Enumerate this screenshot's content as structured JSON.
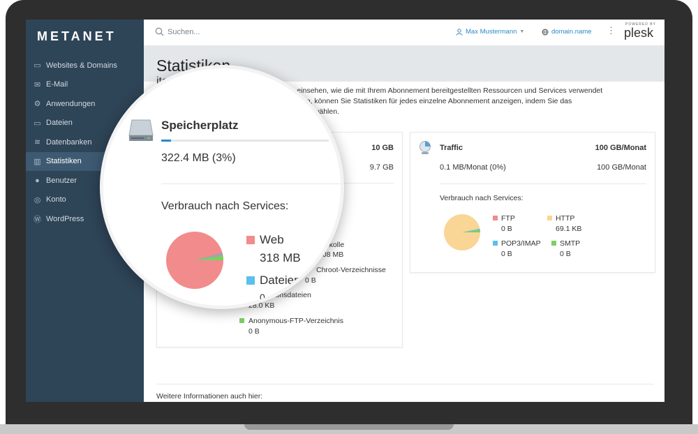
{
  "brand": {
    "logo": "METANET"
  },
  "sidebar": {
    "items": [
      {
        "label": "Websites & Domains",
        "icon": "monitor-icon",
        "glyph": "▭"
      },
      {
        "label": "E-Mail",
        "icon": "mail-icon",
        "glyph": "✉"
      },
      {
        "label": "Anwendungen",
        "icon": "gear-icon",
        "glyph": "⚙"
      },
      {
        "label": "Dateien",
        "icon": "folder-icon",
        "glyph": "▭"
      },
      {
        "label": "Datenbanken",
        "icon": "layers-icon",
        "glyph": "≋"
      },
      {
        "label": "Statistiken",
        "icon": "bar-chart-icon",
        "glyph": "▥",
        "active": true
      },
      {
        "label": "Benutzer",
        "icon": "user-icon",
        "glyph": "●"
      },
      {
        "label": "Konto",
        "icon": "account-icon",
        "glyph": "◎"
      },
      {
        "label": "WordPress",
        "icon": "wordpress-icon",
        "glyph": "Ⓦ"
      }
    ]
  },
  "topbar": {
    "search_placeholder": "Suchen...",
    "user_name": "Max Mustermann",
    "domain": "domain.name",
    "powered_by": "POWERED BY",
    "plesk": "plesk"
  },
  "page": {
    "title": "Statistiken",
    "intro_line1": "ite Abonnement obe",
    "intro_line1b": "iber einsehen, wie die mit Ihrem Abonnement bereitgestellten Ressourcen und Services verwendet",
    "intro_line2": "rt haben, können Sie Statistiken für jedes einzelne Abonnement anzeigen, indem Sie das",
    "intro_line3": "Seite auswählen.",
    "more_info": "Weitere Informationen auch hier:"
  },
  "disk_card": {
    "limit": "10 GB",
    "remaining": "9.7 GB",
    "legend_partial": [
      {
        "label": "otokolle",
        "value": ".08 MB"
      },
      {
        "label": "Chroot-Verzeichnisse",
        "value": "0 B"
      },
      {
        "label": "urationsdateien",
        "value": "28.0 KB"
      },
      {
        "label": "Anonymous-FTP-Verzeichnis",
        "value": "0 B",
        "color": "#7ccf63"
      }
    ]
  },
  "magnifier": {
    "title": "Speicherplatz",
    "usage": "322.4 MB (3%)",
    "breakdown_label": "Verbrauch nach Services:",
    "web_label": "Web",
    "web_value": "318 MB",
    "dateien_label": "Dateien",
    "dateien_tail": "0",
    "colors": {
      "web": "#f28b8b",
      "dateien": "#5bc0eb"
    }
  },
  "traffic_card": {
    "title": "Traffic",
    "limit": "100 GB/Monat",
    "usage": "0.1 MB/Monat (0%)",
    "remaining": "100 GB/Monat",
    "breakdown_label": "Verbrauch nach Services:",
    "legend": [
      {
        "label": "FTP",
        "value": "0 B",
        "color": "#f28b8b"
      },
      {
        "label": "HTTP",
        "value": "69.1 KB",
        "color": "#f9d596"
      },
      {
        "label": "POP3/IMAP",
        "value": "0 B",
        "color": "#5bc0eb"
      },
      {
        "label": "SMTP",
        "value": "0 B",
        "color": "#7ccf63"
      }
    ]
  }
}
